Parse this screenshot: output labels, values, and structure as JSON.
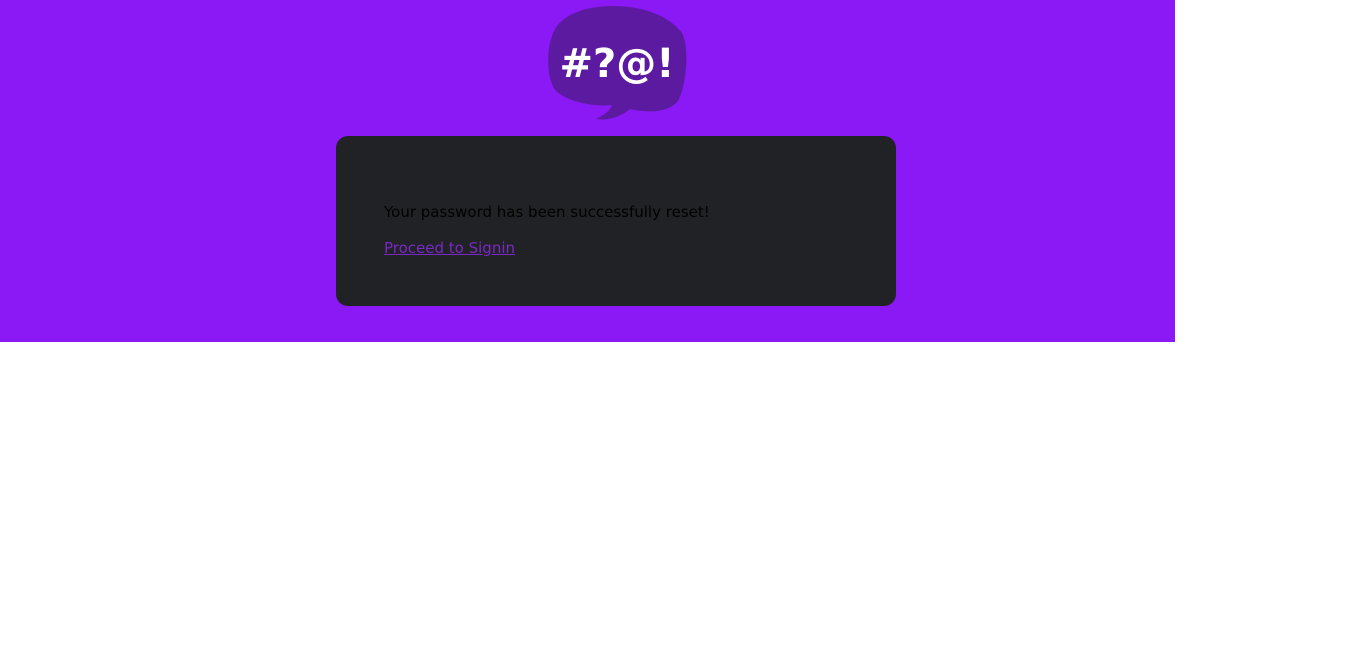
{
  "logo": {
    "glyphs": "#?@!",
    "icon": "speech-bubble-symbols-icon",
    "bubble_color": "#5c1aa0",
    "glyph_color": "#ffffff"
  },
  "colors": {
    "hero_background": "#8a19f5",
    "card_background": "#212225",
    "link": "#7a28c6",
    "page_background": "#ffffff"
  },
  "reset": {
    "message": "Your password has been successfully reset!",
    "signin_link": "Proceed to Signin"
  }
}
